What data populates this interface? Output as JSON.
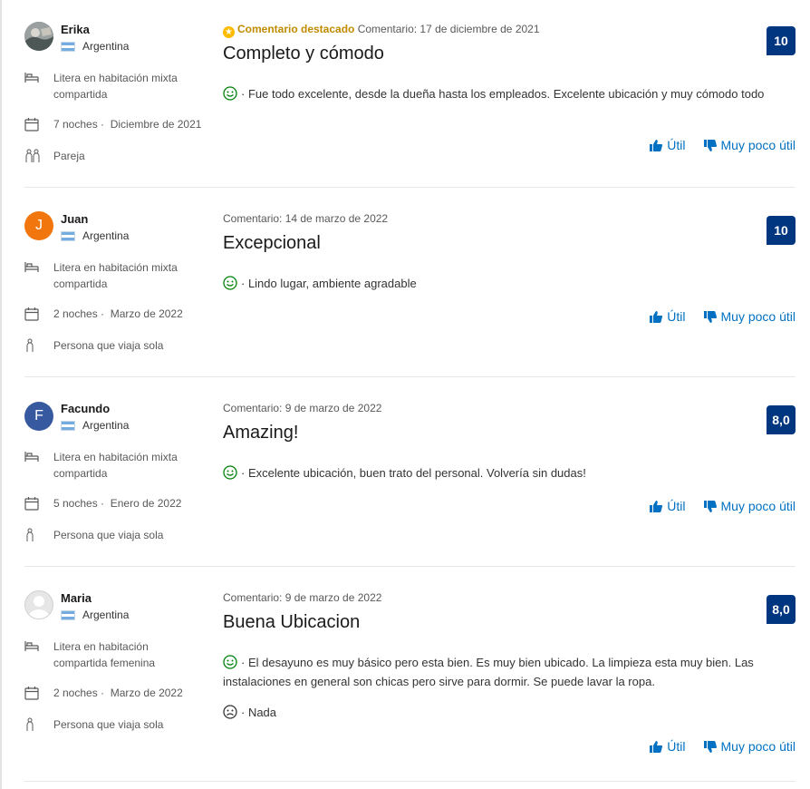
{
  "reviews": [
    {
      "name": "Erika",
      "country": "Argentina",
      "avatar_type": "photo",
      "room": "Litera en habitación mixta compartida",
      "nights": "7 noches ·",
      "stay_date": "Diciembre de 2021",
      "traveler": "Pareja",
      "traveler_icon": "couple-icon",
      "featured_label": "Comentario destacado",
      "date": "Comentario: 17 de diciembre de 2021",
      "title": "Completo y cómodo",
      "score": "10",
      "positive": "· Fue todo excelente, desde la dueña hasta los empleados. Excelente ubicación y muy cómodo todo",
      "negative": "",
      "helpful": "Útil",
      "not_helpful": "Muy poco útil"
    },
    {
      "name": "Juan",
      "country": "Argentina",
      "avatar_letter": "J",
      "avatar_color": "#f0760d",
      "room": "Litera en habitación mixta compartida",
      "nights": "2 noches ·",
      "stay_date": "Marzo de 2022",
      "traveler": "Persona que viaja sola",
      "traveler_icon": "solo-traveler-icon",
      "date": "Comentario: 14 de marzo de 2022",
      "title": "Excepcional",
      "score": "10",
      "positive": "· Lindo lugar, ambiente agradable",
      "negative": "",
      "helpful": "Útil",
      "not_helpful": "Muy poco útil"
    },
    {
      "name": "Facundo",
      "country": "Argentina",
      "avatar_letter": "F",
      "avatar_color": "#36599f",
      "room": "Litera en habitación mixta compartida",
      "nights": "5 noches ·",
      "stay_date": "Enero de 2022",
      "traveler": "Persona que viaja sola",
      "traveler_icon": "solo-traveler-icon",
      "date": "Comentario: 9 de marzo de 2022",
      "title": "Amazing!",
      "score": "8,0",
      "positive": "· Excelente ubicación, buen trato del personal. Volvería sin dudas!",
      "negative": "",
      "helpful": "Útil",
      "not_helpful": "Muy poco útil"
    },
    {
      "name": "Maria",
      "country": "Argentina",
      "avatar_type": "default",
      "room": "Litera en habitación compartida femenina",
      "nights": "2 noches ·",
      "stay_date": "Marzo de 2022",
      "traveler": "Persona que viaja sola",
      "traveler_icon": "solo-traveler-icon",
      "date": "Comentario: 9 de marzo de 2022",
      "title": "Buena Ubicacion",
      "score": "8,0",
      "positive": "· El desayuno es muy básico pero esta bien. Es muy bien ubicado. La limpieza esta muy bien. Las instalaciones en general son chicas pero sirve para dormir. Se puede lavar la ropa.",
      "negative": "· Nada",
      "helpful": "Útil",
      "not_helpful": "Muy poco útil"
    }
  ],
  "colors": {
    "score_bg": "#003580",
    "link": "#0071c2",
    "featured": "#c08b00",
    "positive": "#008009"
  }
}
